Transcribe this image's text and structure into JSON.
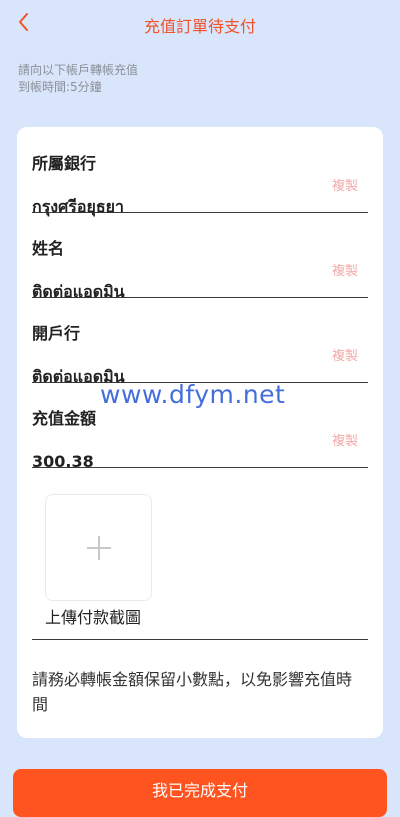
{
  "header": {
    "title": "充值訂單待支付",
    "back_icon": "chevron-left-icon",
    "accent_color": "#f0522a"
  },
  "notice": {
    "line1": "請向以下帳戶轉帳充值",
    "line2": "到帳時間:5分鐘"
  },
  "fields": [
    {
      "label": "所屬銀行",
      "value": "กรุงศรีอยุธยา",
      "copy_label": "複製"
    },
    {
      "label": "姓名",
      "value": "ติดต่อแอดมิน",
      "copy_label": "複製"
    },
    {
      "label": "開戶行",
      "value": "ติดต่อแอดมิน",
      "copy_label": "複製"
    },
    {
      "label": "充值金額",
      "value": "300.38",
      "copy_label": "複製"
    }
  ],
  "upload": {
    "icon": "plus-icon",
    "label": "上傳付款截圖"
  },
  "tip": "請務必轉帳金額保留小數點，以免影響充值時間",
  "watermark": "www.dfym.net",
  "submit_label": "我已完成支付",
  "colors": {
    "background": "#d9e5fb",
    "button": "#ff5320",
    "copy": "#f2a9a9"
  }
}
